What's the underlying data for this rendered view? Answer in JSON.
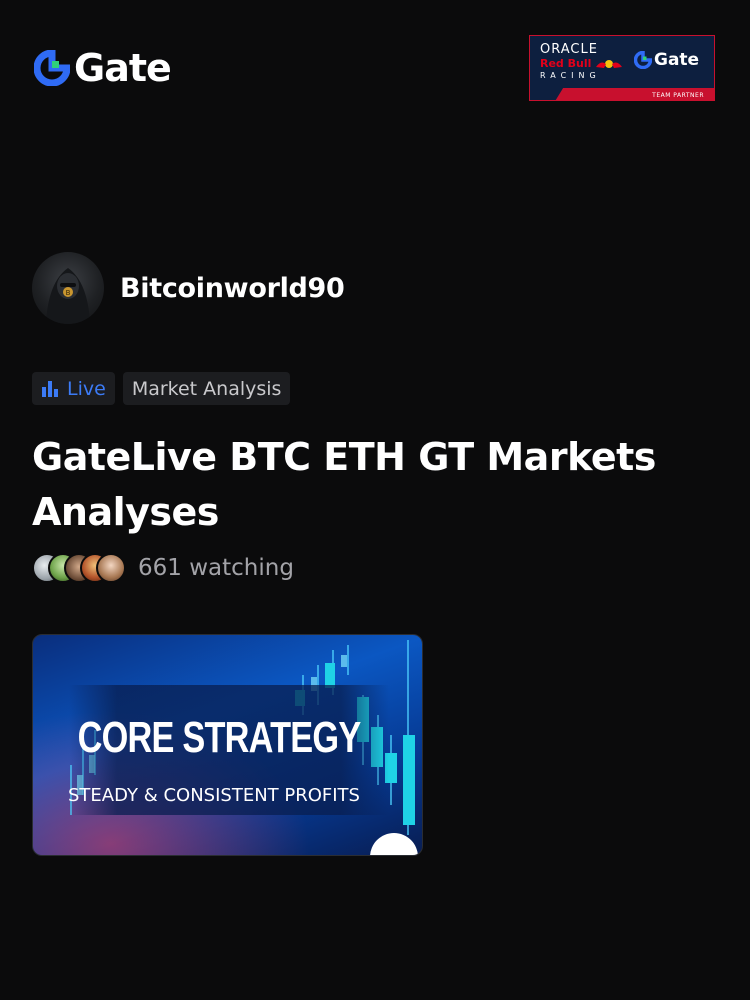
{
  "brand": {
    "logo_text": "Gate",
    "accent_color": "#2f6bf5",
    "partner_badge": {
      "line1": "ORACLE",
      "line2": "Red Bull",
      "line3": "RACING",
      "gate_text": "Gate",
      "strip_text": "TEAM PARTNER"
    }
  },
  "author": {
    "name": "Bitcoinworld90"
  },
  "tags": {
    "live": "Live",
    "category": "Market Analysis"
  },
  "title": "GateLive BTC ETH GT Markets Analyses",
  "viewers": {
    "count_text": "661 watching"
  },
  "thumbnail": {
    "title": "CORE STRATEGY",
    "subtitle": "STEADY & CONSISTENT PROFITS"
  },
  "colors": {
    "background": "#0b0b0c",
    "live_blue": "#3c7bf6",
    "tag_bg": "#1c1d20"
  }
}
